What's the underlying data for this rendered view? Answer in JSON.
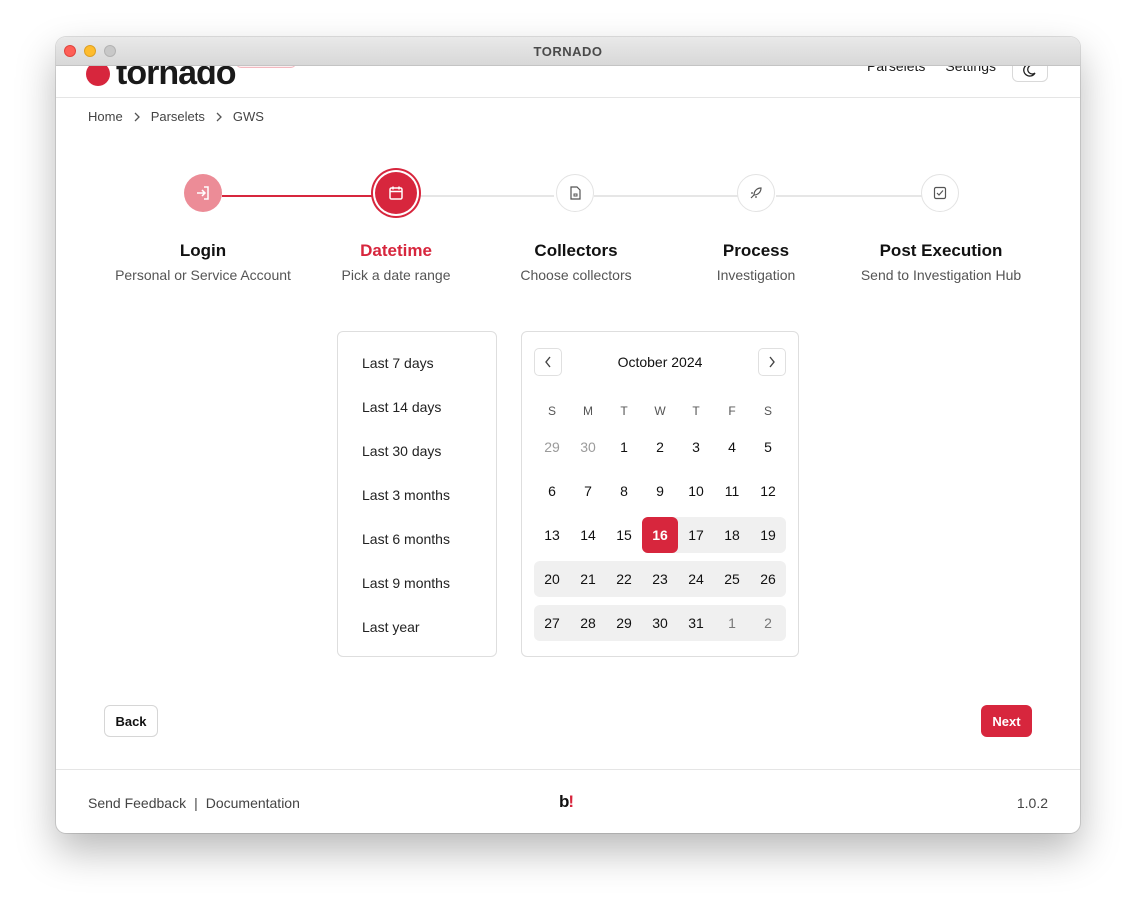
{
  "window": {
    "title": "TORNADO"
  },
  "header": {
    "logo_text": "tornado",
    "nav": [
      "Parselets",
      "Settings"
    ]
  },
  "breadcrumb": [
    "Home",
    "Parselets",
    "GWS"
  ],
  "steps": [
    {
      "title": "Login",
      "subtitle": "Personal or Service Account",
      "state": "done",
      "icon": "login-icon"
    },
    {
      "title": "Datetime",
      "subtitle": "Pick a date range",
      "state": "active",
      "icon": "calendar-icon"
    },
    {
      "title": "Collectors",
      "subtitle": "Choose collectors",
      "state": "todo",
      "icon": "file-icon"
    },
    {
      "title": "Process",
      "subtitle": "Investigation",
      "state": "todo",
      "icon": "rocket-icon"
    },
    {
      "title": "Post Execution",
      "subtitle": "Send to Investigation Hub",
      "state": "todo",
      "icon": "check-square-icon"
    }
  ],
  "presets": [
    "Last 7 days",
    "Last 14 days",
    "Last 30 days",
    "Last 3 months",
    "Last 6 months",
    "Last 9 months",
    "Last year"
  ],
  "calendar": {
    "month_label": "October 2024",
    "weekdays": [
      "S",
      "M",
      "T",
      "W",
      "T",
      "F",
      "S"
    ],
    "weeks": [
      [
        "29",
        "30",
        "1",
        "2",
        "3",
        "4",
        "5"
      ],
      [
        "6",
        "7",
        "8",
        "9",
        "10",
        "11",
        "12"
      ],
      [
        "13",
        "14",
        "15",
        "16",
        "17",
        "18",
        "19"
      ],
      [
        "20",
        "21",
        "22",
        "23",
        "24",
        "25",
        "26"
      ],
      [
        "27",
        "28",
        "29",
        "30",
        "31",
        "1",
        "2"
      ]
    ],
    "selected_day": "16"
  },
  "actions": {
    "back": "Back",
    "next": "Next"
  },
  "footer": {
    "feedback": "Send Feedback",
    "separator": "|",
    "documentation": "Documentation",
    "logo_b": "b",
    "logo_bang": "!",
    "version": "1.0.2"
  },
  "colors": {
    "accent": "#d7263d",
    "accent_light": "#ec8c97",
    "range_bg": "#f0f0f0"
  }
}
